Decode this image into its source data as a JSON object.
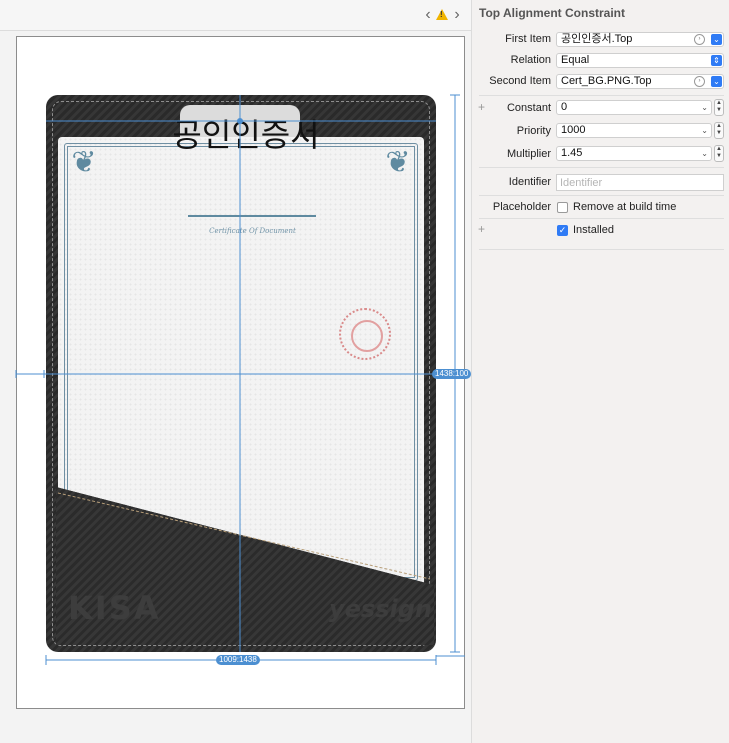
{
  "inspector": {
    "title": "Top Alignment Constraint",
    "first_item": {
      "label": "First Item",
      "value": "공인인증서.Top"
    },
    "relation": {
      "label": "Relation",
      "value": "Equal"
    },
    "second_item": {
      "label": "Second Item",
      "value": "Cert_BG.PNG.Top"
    },
    "constant": {
      "label": "Constant",
      "value": "0"
    },
    "priority": {
      "label": "Priority",
      "value": "1000"
    },
    "multiplier": {
      "label": "Multiplier",
      "value": "1.45"
    },
    "identifier": {
      "label": "Identifier",
      "placeholder": "Identifier"
    },
    "placeholder": {
      "label": "Placeholder",
      "checkbox_label": "Remove at build time",
      "checked": false
    },
    "installed": {
      "label": "Installed",
      "checked": true
    }
  },
  "canvas": {
    "cert_title": "공인인증서",
    "ornament_text": "Certificate Of Document",
    "brand_left": "KISA",
    "brand_right": "yessign",
    "width_constraint_label": "1009:1438",
    "height_constraint_label": "1438:100"
  },
  "colors": {
    "accent": "#2f7bf5",
    "constraint": "#4c8fd1",
    "warning": "#f0b400"
  }
}
